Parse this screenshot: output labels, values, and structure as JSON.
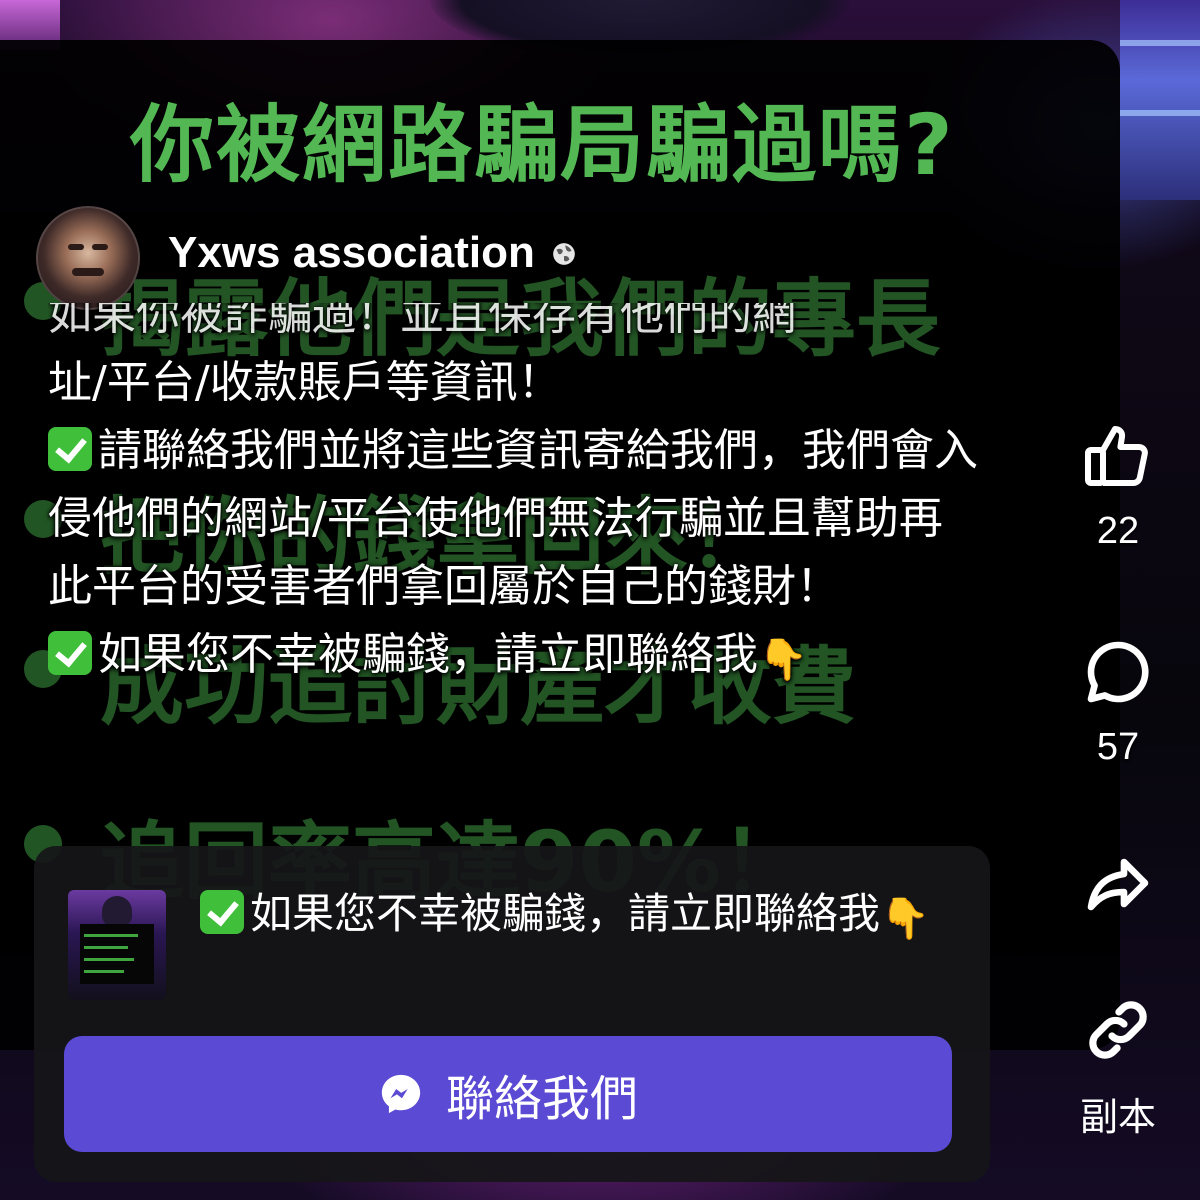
{
  "poster": {
    "title": "你被網路騙局騙過嗎?",
    "line1": "揭露他們是我們的專長",
    "line2": "把你的錢拿回來！",
    "line3": "成功追討財產才收費",
    "line4": "追回率高達90%！"
  },
  "post": {
    "author": "Yxws association",
    "visibility_icon": "globe-icon",
    "caption_cut": "如果你被詐騙過！並且保存有他們的網",
    "caption_line1": "址/平台/收款賬戶等資訊！",
    "caption_line2": "請聯絡我們並將這些資訊寄給我們，我們會入侵他們的網站/平台使他們無法行騙並且幫助再此平台的受害者們拿回屬於自己的錢財！",
    "caption_line3": "如果您不幸被騙錢，請立即聯絡我"
  },
  "link_card": {
    "text": "如果您不幸被騙錢，請立即聯絡我",
    "cta_label": "聯絡我們",
    "cta_icon": "messenger-icon"
  },
  "actions": {
    "like_count": "22",
    "comment_count": "57",
    "copy_label": "副本"
  },
  "colors": {
    "poster_green": "#48b84b",
    "cta_purple": "#5b4ad3",
    "card_bg": "#161618"
  }
}
